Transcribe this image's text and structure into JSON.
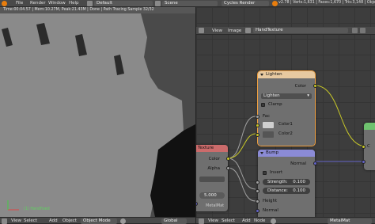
{
  "topbar": {
    "menu": [
      "File",
      "Render",
      "Window",
      "Help"
    ],
    "screen": "Default",
    "scene": "Scene",
    "engine": "Cycles Render",
    "stats": "v2.78 | Verts:1,631 | Faces:1,670 | Tris:3,148 | Objects:0/4"
  },
  "viewport": {
    "render_info": "Time:00:04.57 | Mem:10.27M, Peak:21.43M | Done | Path Tracing Sample 32/32",
    "object_label": "(1) Handfixed",
    "header": {
      "view": "View",
      "select": "Select",
      "add": "Add",
      "object": "Object",
      "mode": "Object Mode",
      "pivot": "Global"
    }
  },
  "node_editor": {
    "header": {
      "view": "View",
      "image": "Image",
      "texture_name": "HandTexture"
    },
    "footer": {
      "view": "View",
      "select": "Select",
      "add": "Add",
      "node": "Node",
      "material": "MetalMat"
    },
    "material_label": "MetalMat",
    "lighten_node": {
      "title": "Lighten",
      "output_color": "Color",
      "blend_mode": "Lighten",
      "clamp": "Clamp",
      "fac": "Fac",
      "color1": "Color1",
      "color2": "Color2"
    },
    "texture_node": {
      "title": "Texture",
      "output_color": "Color",
      "output_alpha": "Alpha",
      "value": "5.000"
    },
    "bump_node": {
      "title": "Bump",
      "output_normal": "Normal",
      "invert": "Invert",
      "strength": "Strength:",
      "strength_value": "0.100",
      "distance": "Distance:",
      "distance_value": "0.100",
      "height": "Height",
      "normal_in": "Normal"
    },
    "shader_node": {
      "label_c": "C"
    }
  },
  "colors": {
    "node_body": "#6f6f6f",
    "node_header_color": "#e7c9a0",
    "node_header_input": "#cb6b6b",
    "node_header_vector": "#8b8bd6",
    "socket_color": "#c7c729",
    "socket_float": "#a1a1a1",
    "socket_vector": "#6363c7",
    "selection_outline": "#f0a040"
  }
}
